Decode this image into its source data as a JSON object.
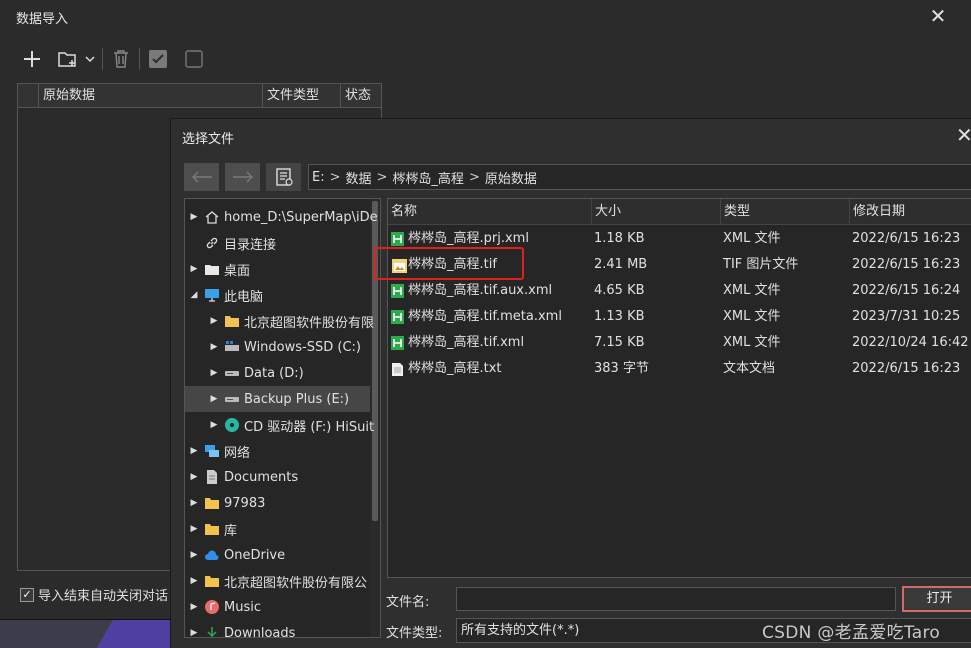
{
  "outer_dialog": {
    "title": "数据导入",
    "grid_columns": [
      "原始数据",
      "文件类型",
      "状态"
    ],
    "auto_close_label": "导入结束自动关闭对话",
    "auto_close_checked": true
  },
  "file_dialog": {
    "title": "选择文件",
    "breadcrumb": [
      "E:",
      "数据",
      "梣梣岛_高程",
      "原始数据"
    ],
    "tree": [
      {
        "label": "home_D:\\SuperMap\\iDe",
        "icon": "home-icon",
        "level": 0,
        "arrow": "▶"
      },
      {
        "label": "目录连接",
        "icon": "link-icon",
        "level": 0,
        "arrow": ""
      },
      {
        "label": "桌面",
        "icon": "desktop-folder-icon",
        "level": 0,
        "arrow": "▶"
      },
      {
        "label": "此电脑",
        "icon": "computer-icon",
        "level": 0,
        "arrow": "◢"
      },
      {
        "label": "北京超图软件股份有限",
        "icon": "folder-icon",
        "level": 1,
        "arrow": "▶"
      },
      {
        "label": "Windows-SSD (C:)",
        "icon": "windows-drive-icon",
        "level": 1,
        "arrow": "▶"
      },
      {
        "label": "Data (D:)",
        "icon": "drive-icon",
        "level": 1,
        "arrow": "▶"
      },
      {
        "label": "Backup Plus (E:)",
        "icon": "drive-icon",
        "level": 1,
        "arrow": "▶",
        "selected": true
      },
      {
        "label": "CD 驱动器 (F:) HiSuit",
        "icon": "cd-drive-icon",
        "level": 1,
        "arrow": "▶"
      },
      {
        "label": "网络",
        "icon": "network-icon",
        "level": 0,
        "arrow": "▶"
      },
      {
        "label": "Documents",
        "icon": "documents-icon",
        "level": 0,
        "arrow": "▶"
      },
      {
        "label": "97983",
        "icon": "folder-icon",
        "level": 0,
        "arrow": "▶"
      },
      {
        "label": "库",
        "icon": "folder-icon",
        "level": 0,
        "arrow": "▶"
      },
      {
        "label": "OneDrive",
        "icon": "cloud-icon",
        "level": 0,
        "arrow": "▶"
      },
      {
        "label": "北京超图软件股份有限公",
        "icon": "folder-icon",
        "level": 0,
        "arrow": "▶"
      },
      {
        "label": "Music",
        "icon": "music-icon",
        "level": 0,
        "arrow": "▶"
      },
      {
        "label": "Downloads",
        "icon": "download-icon",
        "level": 0,
        "arrow": "▶"
      }
    ],
    "file_columns": [
      "名称",
      "大小",
      "类型",
      "修改日期"
    ],
    "files": [
      {
        "name": "梣梣岛_高程.prj.xml",
        "size": "1.18 KB",
        "type": "XML 文件",
        "date": "2022/6/15 16:23",
        "icon": "xml-icon"
      },
      {
        "name": "梣梣岛_高程.tif",
        "size": "2.41 MB",
        "type": "TIF 图片文件",
        "date": "2022/6/15 16:23",
        "icon": "image-icon"
      },
      {
        "name": "梣梣岛_高程.tif.aux.xml",
        "size": "4.65 KB",
        "type": "XML 文件",
        "date": "2022/6/15 16:24",
        "icon": "xml-icon"
      },
      {
        "name": "梣梣岛_高程.tif.meta.xml",
        "size": "1.13 KB",
        "type": "XML 文件",
        "date": "2023/7/31 10:25",
        "icon": "xml-icon"
      },
      {
        "name": "梣梣岛_高程.tif.xml",
        "size": "7.15 KB",
        "type": "XML 文件",
        "date": "2022/10/24 16:42",
        "icon": "xml-icon"
      },
      {
        "name": "梣梣岛_高程.txt",
        "size": "383 字节",
        "type": "文本文档",
        "date": "2022/6/15 16:23",
        "icon": "text-file-icon"
      }
    ],
    "filename_label": "文件名:",
    "filename_value": "",
    "filetype_label": "文件类型:",
    "filetype_value": "所有支持的文件(*.*)",
    "open_label": "打开"
  },
  "watermark": "CSDN @老孟爱吃Taro",
  "colors": {
    "highlight": "#e0201c",
    "xml_icon": "#2fa84f",
    "folder": "#f2c14e"
  }
}
